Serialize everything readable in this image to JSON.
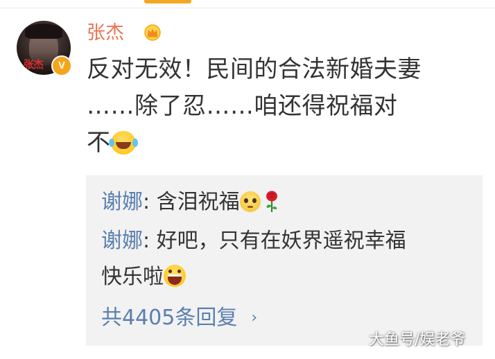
{
  "comment": {
    "author": "张杰",
    "text_line1": "反对无效！民间的合法新婚夫妻",
    "text_line2": "……除了忍……咱还得祝福对",
    "text_line3": "不",
    "avatar_text": "张杰",
    "verified_mark": "V"
  },
  "replies": [
    {
      "name": "谢娜",
      "separator": ": ",
      "text": "含泪祝福"
    },
    {
      "name": "谢娜",
      "separator": ": ",
      "text": "好吧，只有在妖界遥祝幸福",
      "text_line2": "快乐啦"
    }
  ],
  "reply_count_label": "共4405条回复",
  "watermark": "大鱼号/娱老爷",
  "icons": {
    "crown": "crown-icon",
    "laugh_tears": "laughing-tears-emoji",
    "teary": "teary-eyes-emoji",
    "rose": "rose-icon",
    "grin": "grin-emoji",
    "chevron": "chevron-right-icon"
  },
  "colors": {
    "username": "#eb7350",
    "reply_name": "#5a7fb0",
    "body_text": "#333333",
    "reply_bg": "#f2f2f2",
    "verified": "#f3a61c",
    "tab_indicator": "#f5a623"
  }
}
